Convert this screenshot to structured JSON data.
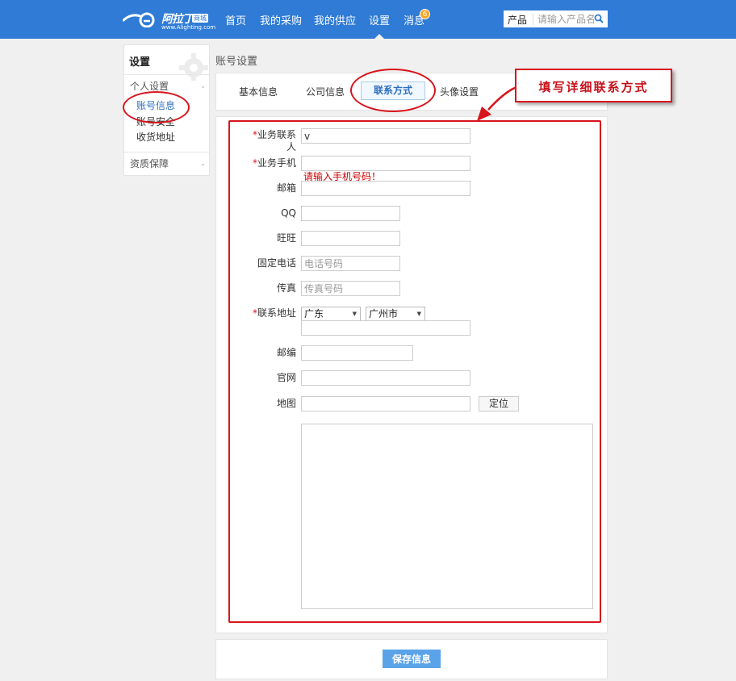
{
  "header": {
    "logo": {
      "brand": "阿拉丁",
      "tag": "商城",
      "url": "www.Alighting.com"
    },
    "nav": [
      {
        "label": "首页"
      },
      {
        "label": "我的采购"
      },
      {
        "label": "我的供应"
      },
      {
        "label": "设置"
      },
      {
        "label": "消息"
      }
    ],
    "message_count": "6",
    "search": {
      "category": "产品",
      "placeholder": "请输入产品名"
    }
  },
  "sidebar": {
    "title": "设置",
    "group_personal": "个人设置",
    "items": [
      {
        "label": "账号信息"
      },
      {
        "label": "账号安全"
      },
      {
        "label": "收货地址"
      }
    ],
    "group_qualification": "资质保障"
  },
  "breadcrumb": "账号设置",
  "tabs": [
    {
      "label": "基本信息"
    },
    {
      "label": "公司信息"
    },
    {
      "label": "联系方式"
    },
    {
      "label": "头像设置"
    }
  ],
  "form": {
    "contact_person": {
      "label": "业务联系人",
      "value": "v"
    },
    "mobile": {
      "label": "业务手机",
      "value": "",
      "error": "请输入手机号码！"
    },
    "email": {
      "label": "邮箱",
      "value": ""
    },
    "qq": {
      "label": "QQ",
      "value": ""
    },
    "wangwang": {
      "label": "旺旺",
      "value": ""
    },
    "phone": {
      "label": "固定电话",
      "placeholder": "电话号码"
    },
    "fax": {
      "label": "传真",
      "placeholder": "传真号码"
    },
    "address": {
      "label": "联系地址",
      "province": "广东",
      "city": "广州市",
      "detail": ""
    },
    "postcode": {
      "label": "邮编",
      "value": ""
    },
    "website": {
      "label": "官网",
      "value": ""
    },
    "map": {
      "label": "地图",
      "value": "",
      "locate_button": "定位"
    },
    "required_mark": "*"
  },
  "save_button": "保存信息",
  "annotation": {
    "callout_text": "填写详细联系方式"
  },
  "colors": {
    "header_bg": "#2f7bd6",
    "annotation_red": "#d8141c",
    "primary_button": "#5aa3e8",
    "badge": "#f5a623"
  }
}
